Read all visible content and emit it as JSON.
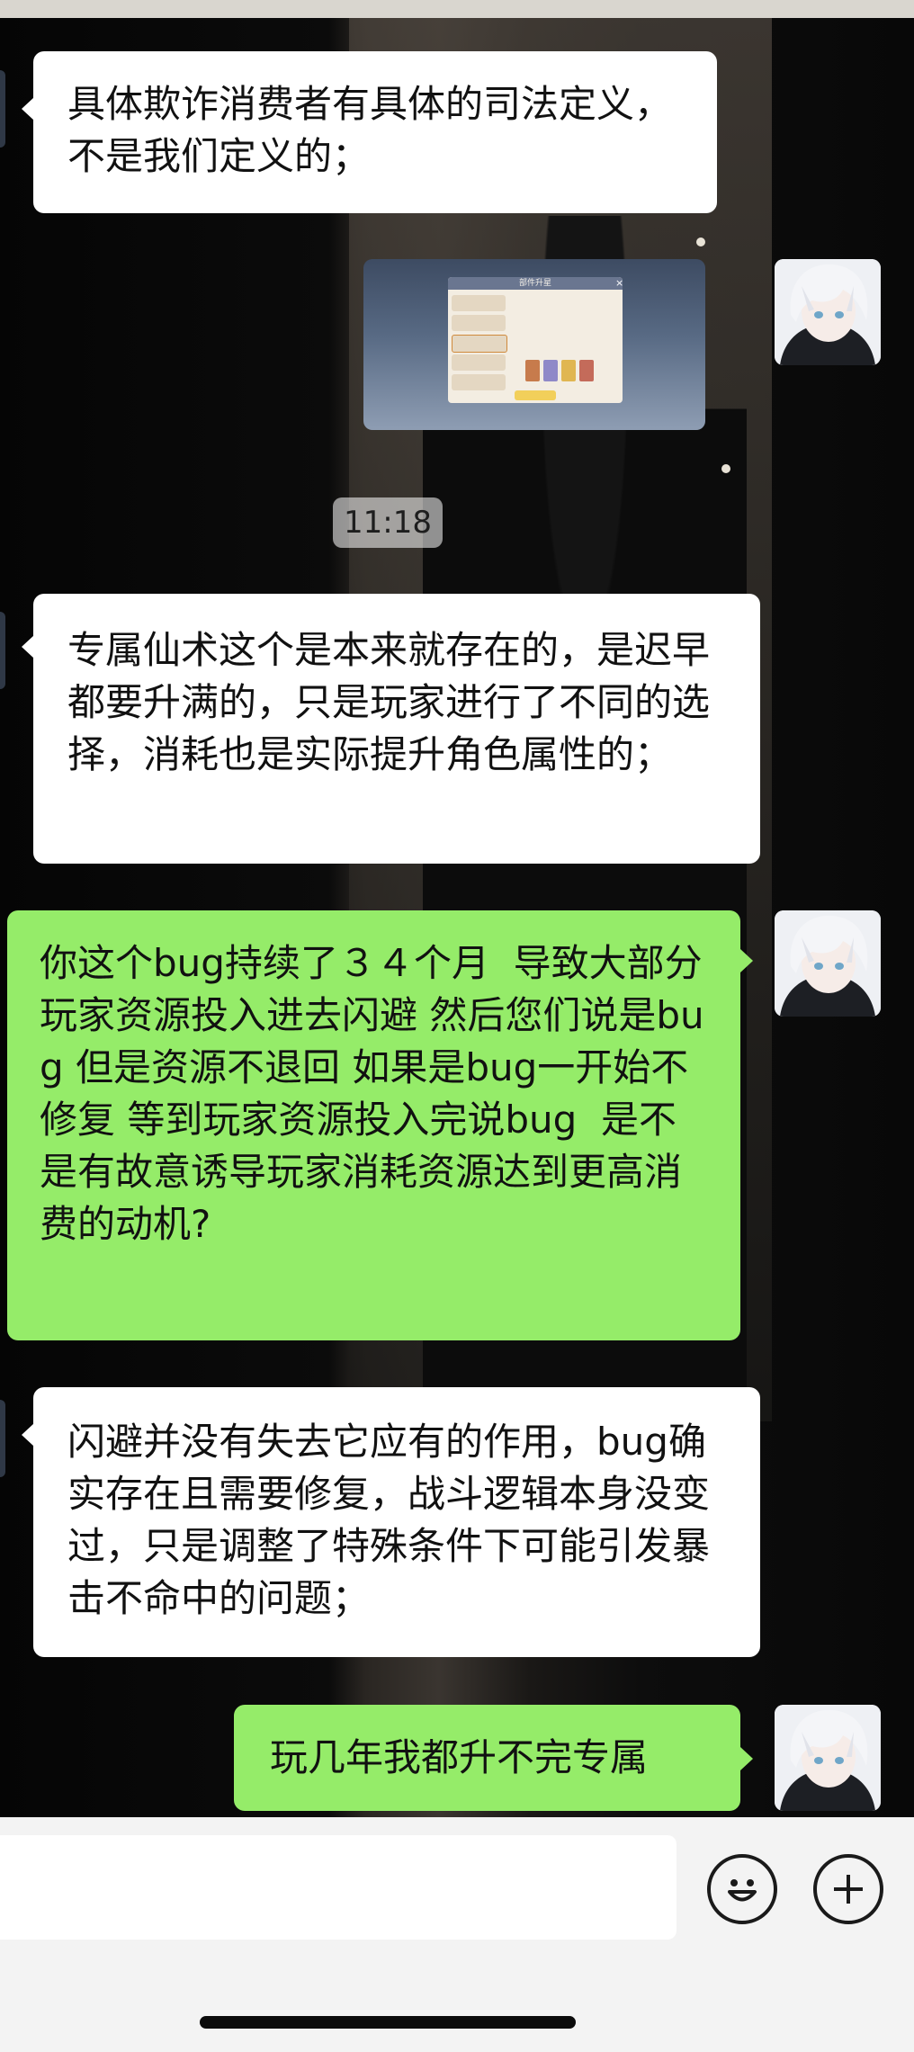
{
  "messages": [
    {
      "side": "left",
      "type": "text",
      "text": "具体欺诈消费者有具体的司法定义，不是我们定义的；"
    },
    {
      "side": "right",
      "type": "image",
      "image_title": "部件升星"
    },
    {
      "type": "timestamp",
      "text": "11:18"
    },
    {
      "side": "left",
      "type": "text",
      "text": "专属仙术这个是本来就存在的，是迟早都要升满的，只是玩家进行了不同的选择，消耗也是实际提升角色属性的；"
    },
    {
      "side": "right",
      "type": "text",
      "text": "你这个bug持续了３４个月  导致大部分玩家资源投入进去闪避 然后您们说是bug 但是资源不退回 如果是bug一开始不修复 等到玩家资源投入完说bug  是不是有故意诱导玩家消耗资源达到更高消费的动机?"
    },
    {
      "side": "left",
      "type": "text",
      "text": "闪避并没有失去它应有的作用，bug确实存在且需要修复，战斗逻辑本身没变过，只是调整了特殊条件下可能引发暴击不命中的问题；"
    },
    {
      "side": "right",
      "type": "text",
      "text": "玩几年我都升不完专属"
    }
  ],
  "icons": {
    "emoji": "smiley-face-icon",
    "more": "plus-circle-icon"
  },
  "colors": {
    "bubble_self": "#95ec69",
    "bubble_other": "#ffffff",
    "input_bar": "#f3f3f3"
  }
}
